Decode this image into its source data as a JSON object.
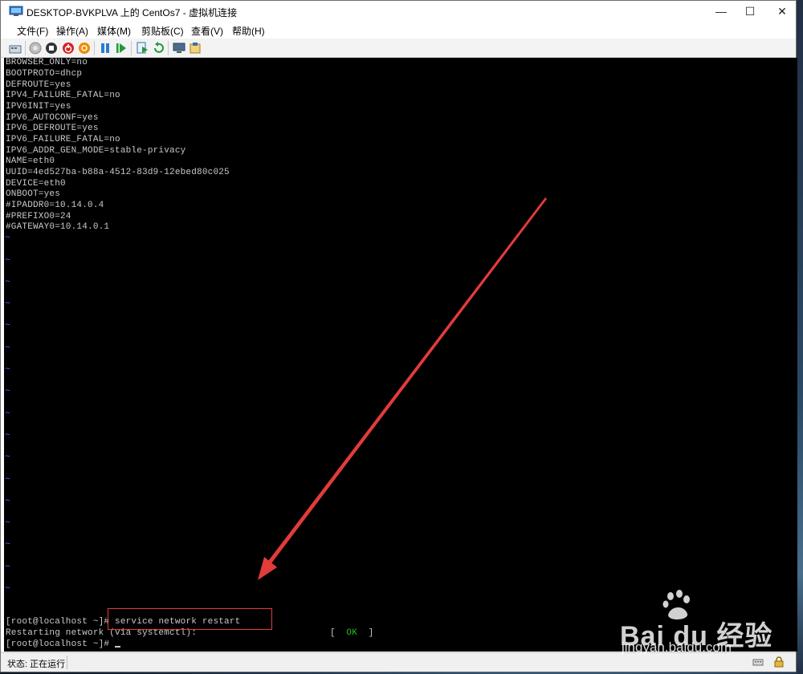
{
  "window": {
    "title": "DESKTOP-BVKPLVA 上的 CentOs7 - 虚拟机连接",
    "minimize_glyph": "—",
    "maximize_glyph": "☐",
    "close_glyph": "✕"
  },
  "menu": [
    {
      "label": "文件(F)"
    },
    {
      "label": "操作(A)"
    },
    {
      "label": "媒体(M)"
    },
    {
      "label": "剪贴板(C)"
    },
    {
      "label": "查看(V)"
    },
    {
      "label": "帮助(H)"
    }
  ],
  "toolbar_icons": [
    "ctrl-alt-del-icon",
    "start-icon",
    "turn-off-icon",
    "shutdown-icon",
    "save-state-icon",
    "pause-icon",
    "resume-icon",
    "checkpoint-icon",
    "revert-icon",
    "enhanced-session-icon",
    "share-icon"
  ],
  "console": {
    "config_lines": [
      "BROWSER_ONLY=no",
      "BOOTPROTO=dhcp",
      "DEFROUTE=yes",
      "IPV4_FAILURE_FATAL=no",
      "IPV6INIT=yes",
      "IPV6_AUTOCONF=yes",
      "IPV6_DEFROUTE=yes",
      "IPV6_FAILURE_FATAL=no",
      "IPV6_ADDR_GEN_MODE=stable-privacy",
      "NAME=eth0",
      "UUID=4ed527ba-b88a-4512-83d9-12ebed80c025",
      "DEVICE=eth0",
      "ONBOOT=yes",
      "#IPADDR0=10.14.0.4",
      "#PREFIXO0=24",
      "#GATEWAY0=10.14.0.1"
    ],
    "tilde": "~",
    "prompt_1": "[root@localhost ~]# ",
    "command": "service network restart",
    "restart_msg": "Restarting network (via systemctl):",
    "ok_open": "[  ",
    "ok_text": "OK",
    "ok_close": "  ]",
    "prompt_2": "[root@localhost ~]# "
  },
  "status": {
    "text": "状态: 正在运行"
  },
  "watermark": {
    "logo": "Bai du 经验",
    "url": "jingyan.baidu.com"
  },
  "colors": {
    "console_bg": "#000000",
    "console_text": "#c9c9c9",
    "tilde": "#4a6cff",
    "ok": "#21c21b",
    "annotation_red": "#e23b3b"
  }
}
